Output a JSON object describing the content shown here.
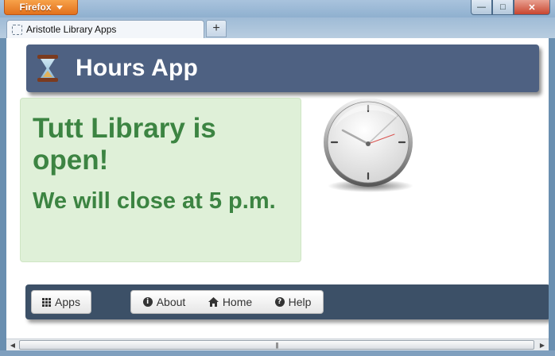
{
  "browser": {
    "menu_label": "Firefox",
    "tab_title": "Aristotle Library Apps",
    "new_tab_symbol": "+",
    "window_controls": {
      "minimize": "—",
      "maximize": "□",
      "close": "✕"
    }
  },
  "header": {
    "title": "Hours App",
    "icon": "hourglass-icon"
  },
  "status": {
    "message": "Tutt Library is open!",
    "closing": "We will close at 5 p.m.",
    "colors": {
      "background": "#dff0d8",
      "text": "#3c8442"
    }
  },
  "footer": {
    "apps_label": "Apps",
    "about_label": "About",
    "home_label": "Home",
    "help_label": "Help"
  },
  "scrollbar": {
    "grip": "|||"
  },
  "colors": {
    "header": "#4e6182",
    "footer": "#3c5067",
    "firefox_orange": "#e2711c"
  }
}
